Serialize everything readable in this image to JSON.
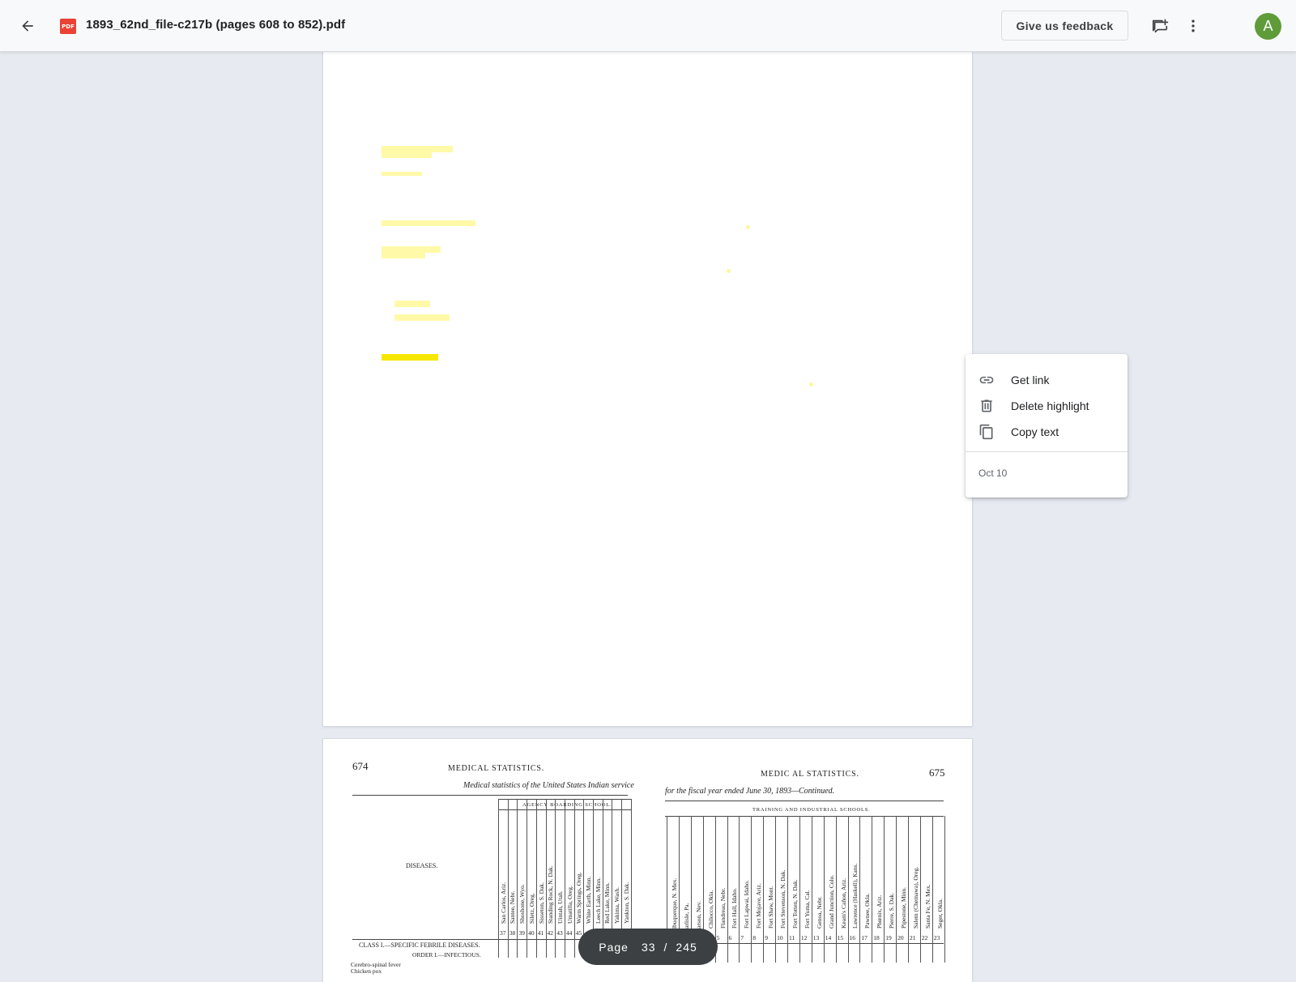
{
  "header": {
    "file_icon_label": "PDF",
    "filename": "1893_62nd_file-c217b (pages 608 to 852).pdf",
    "feedback_label": "Give us feedback",
    "avatar_letter": "A",
    "icons": [
      "arrow-back-icon",
      "pdf-file-icon",
      "add-comment-icon",
      "more-vert-icon"
    ]
  },
  "context_menu": {
    "items": [
      {
        "label": "Get link",
        "icon": "link-icon"
      },
      {
        "label": "Delete highlight",
        "icon": "trash-icon"
      },
      {
        "label": "Copy text",
        "icon": "copy-icon"
      }
    ],
    "date": "Oct 10"
  },
  "pagination": {
    "label": "Page",
    "current": "33",
    "separator": "/",
    "total": "245"
  },
  "highlight_colors": {
    "active": "#f7e600",
    "inactive": "#fff9a8"
  },
  "scanned_page": {
    "left_page_number": "674",
    "right_page_number": "675",
    "left_running_head": "MEDICAL  STATISTICS.",
    "right_running_head": "MEDIC AL  STATISTICS.",
    "left_subtitle": "Medical statistics of the United States Indian service",
    "right_subtitle": "for the fiscal year ended June 30, 1893—Continued.",
    "left_group_head": "AGENCY BOARDING SCHOOL.",
    "right_group_head": "TRAINING AND INDUSTRIAL SCHOOLS.",
    "diseases_label": "DISEASES.",
    "class_label": "CLASS I.—SPECIFIC FEBRILE DISEASES.",
    "order_label": "ORDER I.—INFECTIOUS.",
    "rows": [
      "Cerebro-spinal fever",
      "Chicken pox"
    ],
    "left_columns": [
      {
        "name": "San Carlos, Ariz.",
        "num": "37"
      },
      {
        "name": "Santee, Nebr.",
        "num": "38"
      },
      {
        "name": "Shoshone, Wyo.",
        "num": "39"
      },
      {
        "name": "Siletz, Oreg.",
        "num": "40"
      },
      {
        "name": "Sisseton, S. Dak.",
        "num": "41"
      },
      {
        "name": "Standing Rock, N. Dak.",
        "num": "42"
      },
      {
        "name": "Uintah, Utah.",
        "num": "43"
      },
      {
        "name": "Umatilla, Oreg.",
        "num": "44"
      },
      {
        "name": "Warm Springs, Oreg.",
        "num": "45"
      },
      {
        "name": "White Earth, Minn.",
        "num": ""
      },
      {
        "name": "Leech Lake, Minn.",
        "num": ""
      },
      {
        "name": "Red Lake, Minn.",
        "num": ""
      },
      {
        "name": "Yakima, Wash.",
        "num": ""
      },
      {
        "name": "Yankton, S. Dak.",
        "num": ""
      }
    ],
    "right_columns": [
      {
        "name": "lbuquerque, N. Mex.",
        "num": ""
      },
      {
        "name": "arlisle, Pa.",
        "num": ""
      },
      {
        "name": "arson, Nev.",
        "num": ""
      },
      {
        "name": "Chilocco, Okla.",
        "num": ""
      },
      {
        "name": "Flandreau, Nebr.",
        "num": "5"
      },
      {
        "name": "Fort Hall, Idaho.",
        "num": "6"
      },
      {
        "name": "Fort Lapwai, Idaho.",
        "num": "7"
      },
      {
        "name": "Fort Mojave, Ariz.",
        "num": "8"
      },
      {
        "name": "Fort Shaw, Mont.",
        "num": "9"
      },
      {
        "name": "Fort Stevenson, N. Dak.",
        "num": "10"
      },
      {
        "name": "Fort Totten, N. Dak.",
        "num": "11"
      },
      {
        "name": "Fort Yuma, Cal.",
        "num": "12"
      },
      {
        "name": "Genoa, Nebr.",
        "num": "13"
      },
      {
        "name": "Grand Junction, Colo.",
        "num": "14"
      },
      {
        "name": "Keam's Cañon, Ariz.",
        "num": "15"
      },
      {
        "name": "Lawrence (Haskell), Kans.",
        "num": "16"
      },
      {
        "name": "Pawnee, Okla.",
        "num": "17"
      },
      {
        "name": "Phœnix, Ariz.",
        "num": "18"
      },
      {
        "name": "Pierre, S. Dak.",
        "num": "19"
      },
      {
        "name": "Pipestone, Minn.",
        "num": "20"
      },
      {
        "name": "Salem (Chemawa), Oreg.",
        "num": "21"
      },
      {
        "name": "Santa Fe, N. Mex.",
        "num": "22"
      },
      {
        "name": "Seger, Okla.",
        "num": "23"
      }
    ]
  }
}
